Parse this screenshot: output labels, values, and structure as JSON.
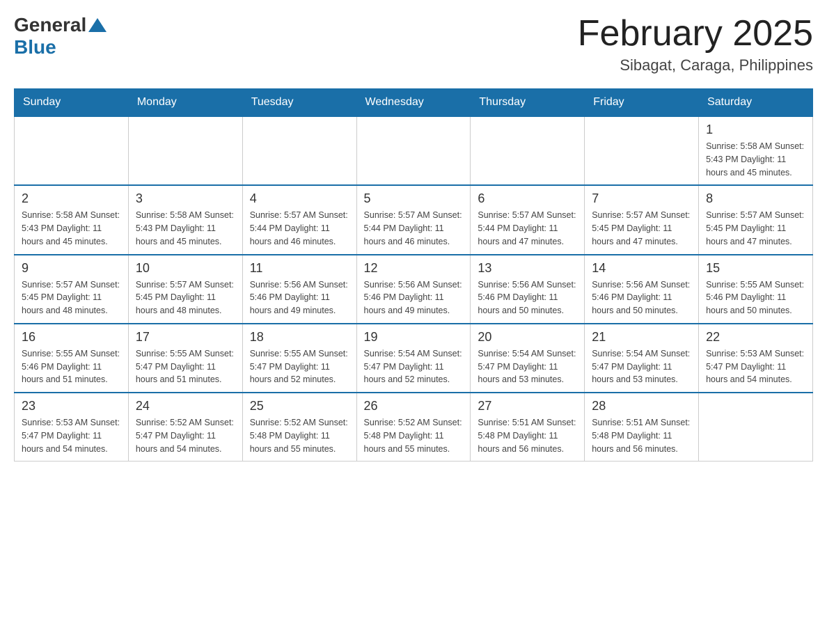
{
  "logo": {
    "general": "General",
    "blue": "Blue",
    "triangle": "▲"
  },
  "header": {
    "month": "February 2025",
    "location": "Sibagat, Caraga, Philippines"
  },
  "days_of_week": [
    "Sunday",
    "Monday",
    "Tuesday",
    "Wednesday",
    "Thursday",
    "Friday",
    "Saturday"
  ],
  "weeks": [
    [
      {
        "day": "",
        "info": ""
      },
      {
        "day": "",
        "info": ""
      },
      {
        "day": "",
        "info": ""
      },
      {
        "day": "",
        "info": ""
      },
      {
        "day": "",
        "info": ""
      },
      {
        "day": "",
        "info": ""
      },
      {
        "day": "1",
        "info": "Sunrise: 5:58 AM\nSunset: 5:43 PM\nDaylight: 11 hours\nand 45 minutes."
      }
    ],
    [
      {
        "day": "2",
        "info": "Sunrise: 5:58 AM\nSunset: 5:43 PM\nDaylight: 11 hours\nand 45 minutes."
      },
      {
        "day": "3",
        "info": "Sunrise: 5:58 AM\nSunset: 5:43 PM\nDaylight: 11 hours\nand 45 minutes."
      },
      {
        "day": "4",
        "info": "Sunrise: 5:57 AM\nSunset: 5:44 PM\nDaylight: 11 hours\nand 46 minutes."
      },
      {
        "day": "5",
        "info": "Sunrise: 5:57 AM\nSunset: 5:44 PM\nDaylight: 11 hours\nand 46 minutes."
      },
      {
        "day": "6",
        "info": "Sunrise: 5:57 AM\nSunset: 5:44 PM\nDaylight: 11 hours\nand 47 minutes."
      },
      {
        "day": "7",
        "info": "Sunrise: 5:57 AM\nSunset: 5:45 PM\nDaylight: 11 hours\nand 47 minutes."
      },
      {
        "day": "8",
        "info": "Sunrise: 5:57 AM\nSunset: 5:45 PM\nDaylight: 11 hours\nand 47 minutes."
      }
    ],
    [
      {
        "day": "9",
        "info": "Sunrise: 5:57 AM\nSunset: 5:45 PM\nDaylight: 11 hours\nand 48 minutes."
      },
      {
        "day": "10",
        "info": "Sunrise: 5:57 AM\nSunset: 5:45 PM\nDaylight: 11 hours\nand 48 minutes."
      },
      {
        "day": "11",
        "info": "Sunrise: 5:56 AM\nSunset: 5:46 PM\nDaylight: 11 hours\nand 49 minutes."
      },
      {
        "day": "12",
        "info": "Sunrise: 5:56 AM\nSunset: 5:46 PM\nDaylight: 11 hours\nand 49 minutes."
      },
      {
        "day": "13",
        "info": "Sunrise: 5:56 AM\nSunset: 5:46 PM\nDaylight: 11 hours\nand 50 minutes."
      },
      {
        "day": "14",
        "info": "Sunrise: 5:56 AM\nSunset: 5:46 PM\nDaylight: 11 hours\nand 50 minutes."
      },
      {
        "day": "15",
        "info": "Sunrise: 5:55 AM\nSunset: 5:46 PM\nDaylight: 11 hours\nand 50 minutes."
      }
    ],
    [
      {
        "day": "16",
        "info": "Sunrise: 5:55 AM\nSunset: 5:46 PM\nDaylight: 11 hours\nand 51 minutes."
      },
      {
        "day": "17",
        "info": "Sunrise: 5:55 AM\nSunset: 5:47 PM\nDaylight: 11 hours\nand 51 minutes."
      },
      {
        "day": "18",
        "info": "Sunrise: 5:55 AM\nSunset: 5:47 PM\nDaylight: 11 hours\nand 52 minutes."
      },
      {
        "day": "19",
        "info": "Sunrise: 5:54 AM\nSunset: 5:47 PM\nDaylight: 11 hours\nand 52 minutes."
      },
      {
        "day": "20",
        "info": "Sunrise: 5:54 AM\nSunset: 5:47 PM\nDaylight: 11 hours\nand 53 minutes."
      },
      {
        "day": "21",
        "info": "Sunrise: 5:54 AM\nSunset: 5:47 PM\nDaylight: 11 hours\nand 53 minutes."
      },
      {
        "day": "22",
        "info": "Sunrise: 5:53 AM\nSunset: 5:47 PM\nDaylight: 11 hours\nand 54 minutes."
      }
    ],
    [
      {
        "day": "23",
        "info": "Sunrise: 5:53 AM\nSunset: 5:47 PM\nDaylight: 11 hours\nand 54 minutes."
      },
      {
        "day": "24",
        "info": "Sunrise: 5:52 AM\nSunset: 5:47 PM\nDaylight: 11 hours\nand 54 minutes."
      },
      {
        "day": "25",
        "info": "Sunrise: 5:52 AM\nSunset: 5:48 PM\nDaylight: 11 hours\nand 55 minutes."
      },
      {
        "day": "26",
        "info": "Sunrise: 5:52 AM\nSunset: 5:48 PM\nDaylight: 11 hours\nand 55 minutes."
      },
      {
        "day": "27",
        "info": "Sunrise: 5:51 AM\nSunset: 5:48 PM\nDaylight: 11 hours\nand 56 minutes."
      },
      {
        "day": "28",
        "info": "Sunrise: 5:51 AM\nSunset: 5:48 PM\nDaylight: 11 hours\nand 56 minutes."
      },
      {
        "day": "",
        "info": ""
      }
    ]
  ]
}
